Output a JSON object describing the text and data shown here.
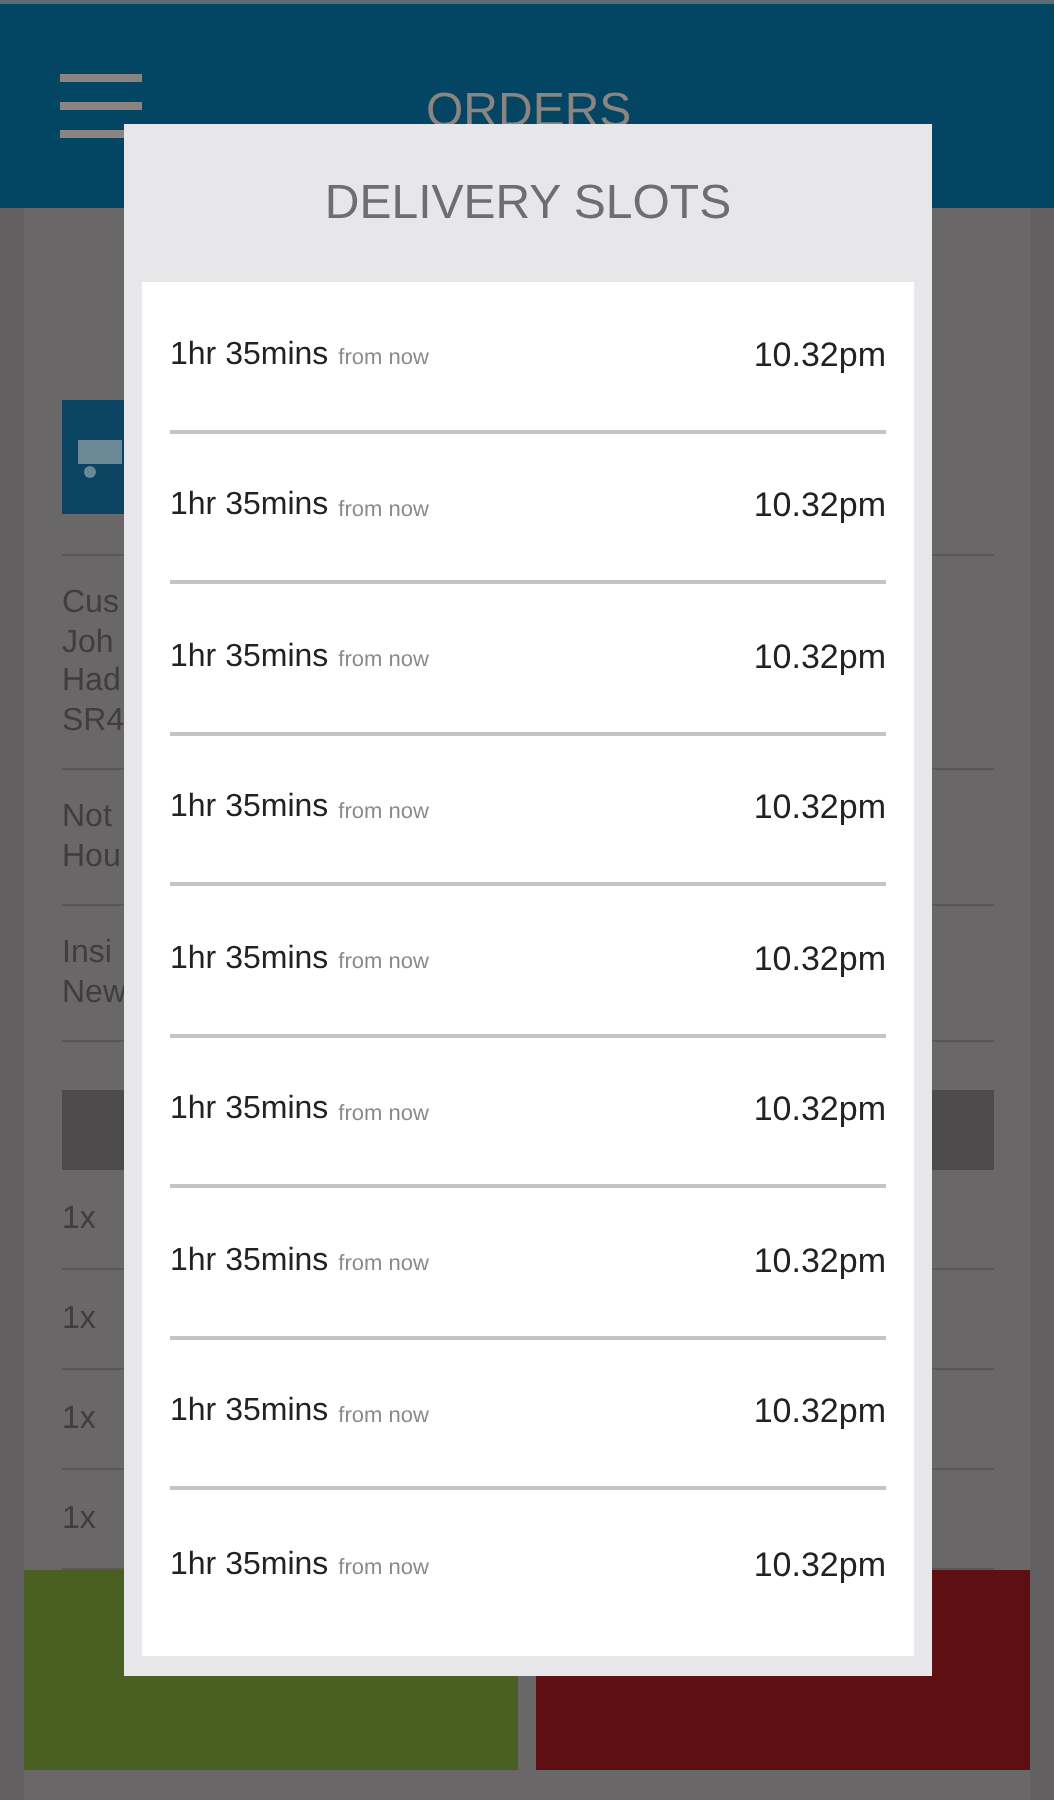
{
  "header": {
    "title": "ORDERS"
  },
  "order": {
    "details": [
      {
        "lines": [
          "Cus",
          "Joh",
          "Had",
          "SR4"
        ]
      },
      {
        "lines": [
          "Not",
          "Hou"
        ]
      },
      {
        "lines": [
          "Insi",
          "New"
        ]
      }
    ],
    "items": [
      "1x",
      "1x",
      "1x",
      "1x"
    ]
  },
  "dialog": {
    "title": "DELIVERY SLOTS",
    "slots": [
      {
        "duration": "1hr 35mins",
        "note": "from now",
        "time": "10.32pm"
      },
      {
        "duration": "1hr 35mins",
        "note": "from now",
        "time": "10.32pm"
      },
      {
        "duration": "1hr 35mins",
        "note": "from now",
        "time": "10.32pm"
      },
      {
        "duration": "1hr 35mins",
        "note": "from now",
        "time": "10.32pm"
      },
      {
        "duration": "1hr 35mins",
        "note": "from now",
        "time": "10.32pm"
      },
      {
        "duration": "1hr 35mins",
        "note": "from now",
        "time": "10.32pm"
      },
      {
        "duration": "1hr 35mins",
        "note": "from now",
        "time": "10.32pm"
      },
      {
        "duration": "1hr 35mins",
        "note": "from now",
        "time": "10.32pm"
      },
      {
        "duration": "1hr 35mins",
        "note": "from now",
        "time": "10.32pm"
      }
    ]
  }
}
